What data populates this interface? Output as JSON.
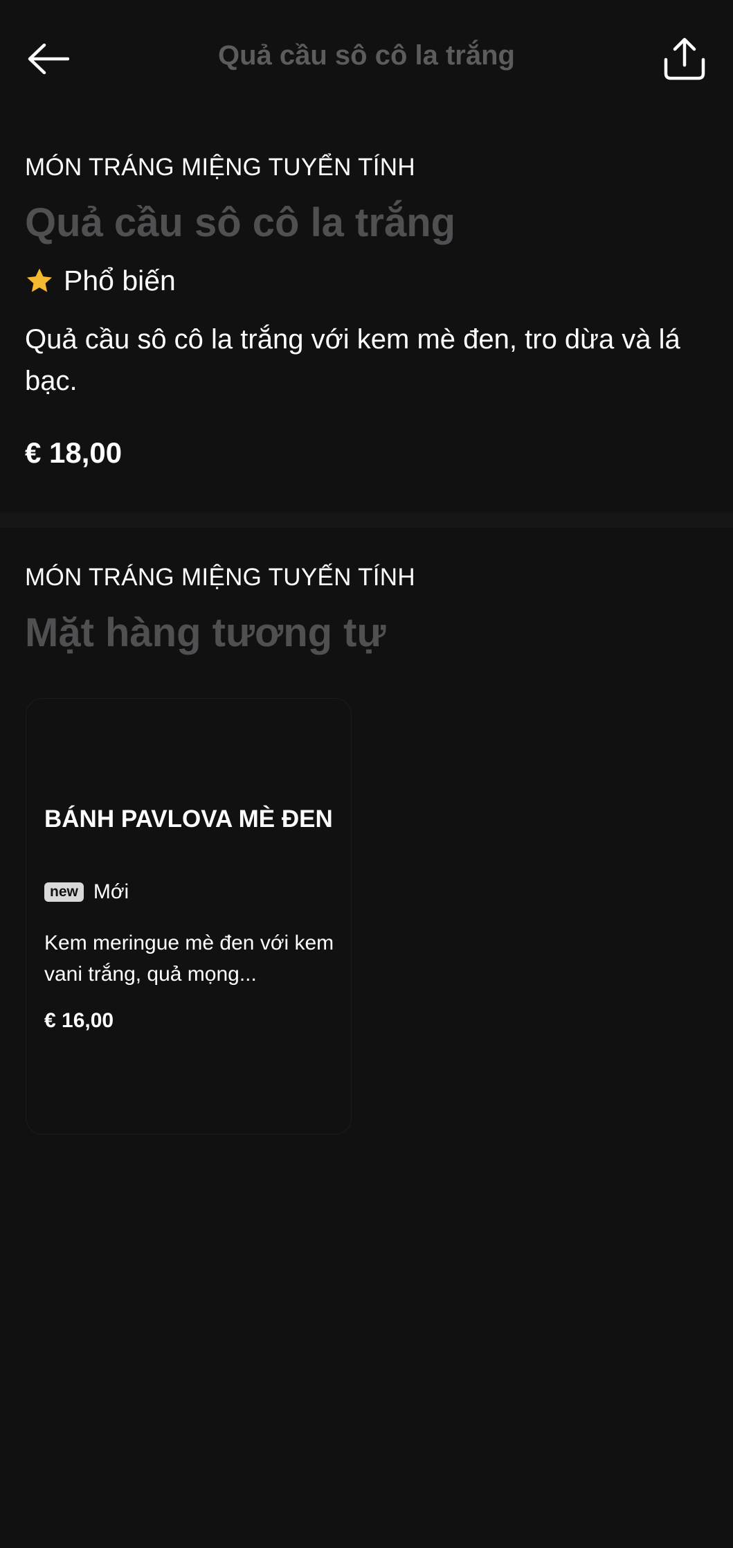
{
  "header": {
    "title": "Quả cầu sô cô la trắng",
    "back_icon": "arrow-left-icon",
    "share_icon": "share-icon"
  },
  "product": {
    "category": "MÓN TRÁNG MIỆNG TUYỂN TÍNH",
    "name": "Quả cầu sô cô la trắng",
    "tag": "Phổ biến",
    "tag_icon": "star-icon",
    "description": "Quả cầu sô cô la trắng với kem mè đen, tro dừa và lá bạc.",
    "price": "€ 18,00"
  },
  "similar": {
    "category": "MÓN TRÁNG MIỆNG TUYẾN TÍNH",
    "title": "Mặt hàng tương tự",
    "items": [
      {
        "name": "BÁNH PAVLOVA MÈ ĐEN",
        "badge": "new",
        "badge_label": "Mới",
        "description": "Kem meringue mè đen với kem vani trắng, quả mọng...",
        "price": "€ 16,00"
      }
    ]
  },
  "colors": {
    "background": "#111112",
    "muted_title": "#505052",
    "star": "#f5b82e",
    "badge_bg": "#d9d9d9"
  }
}
